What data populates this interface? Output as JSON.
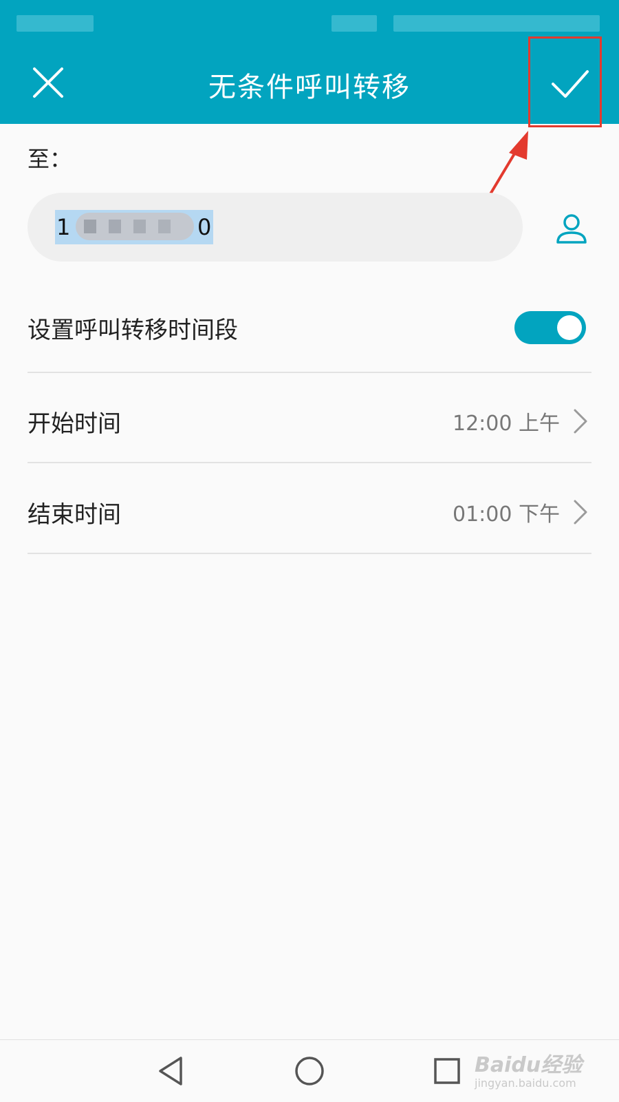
{
  "app_bar": {
    "title": "无条件呼叫转移",
    "close_icon": "close-icon",
    "confirm_icon": "checkmark-icon"
  },
  "forward_to": {
    "label": "至：",
    "number_first_digit": "1",
    "number_last_digit": "0",
    "contact_icon": "person-icon"
  },
  "time_period": {
    "label": "设置呼叫转移时间段",
    "enabled": true
  },
  "start_time": {
    "label": "开始时间",
    "value": "12:00 上午"
  },
  "end_time": {
    "label": "结束时间",
    "value": "01:00 下午"
  },
  "nav_bar": {
    "back_icon": "back-triangle-icon",
    "home_icon": "home-circle-icon",
    "recents_icon": "recents-square-icon"
  },
  "watermark": {
    "brand": "Baidu经验",
    "url": "jingyan.baidu.com"
  },
  "colors": {
    "accent": "#02a4bf",
    "annotation": "#e33a2e",
    "selection": "#b5d8f2"
  }
}
